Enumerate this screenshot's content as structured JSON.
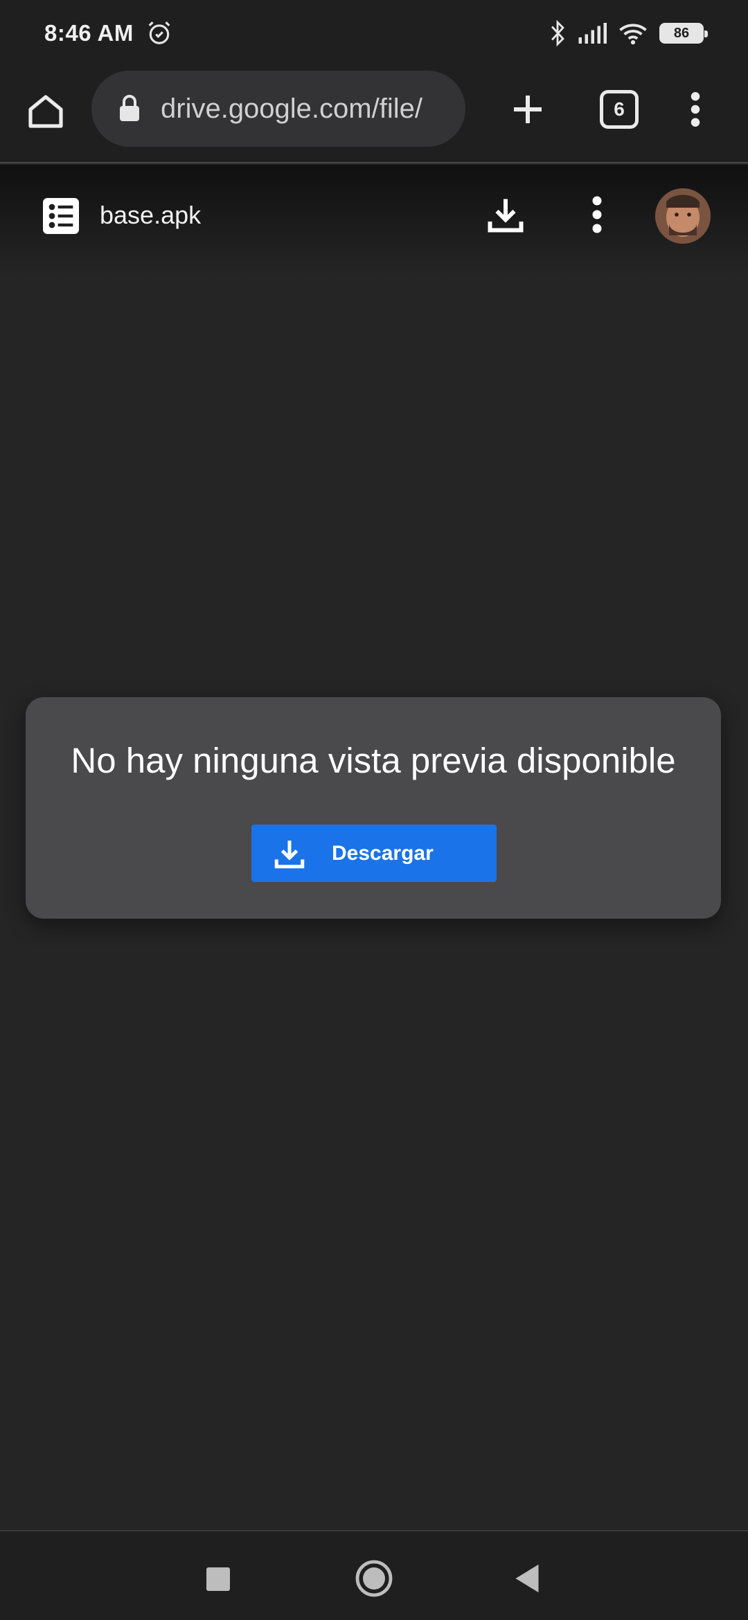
{
  "status_bar": {
    "time": "8:46 AM",
    "battery_level": "86",
    "icons": [
      "alarm-icon",
      "bluetooth-icon",
      "signal-icon",
      "wifi-icon",
      "battery-icon"
    ]
  },
  "browser": {
    "url": "drive.google.com/file/",
    "tab_count": "6",
    "icons": [
      "home-icon",
      "lock-icon",
      "new-tab-icon",
      "tab-switcher-icon",
      "more-vert-icon"
    ]
  },
  "drive": {
    "file_name": "base.apk",
    "icons": [
      "file-type-icon",
      "download-icon",
      "more-vert-icon",
      "avatar"
    ]
  },
  "preview": {
    "message": "No hay ninguna vista previa disponible",
    "download_label": "Descargar"
  },
  "colors": {
    "background": "#252525",
    "card": "#4a494c",
    "accent": "#1a73e8"
  },
  "nav_bar": {
    "icons": [
      "recents-icon",
      "home-circle-icon",
      "back-icon"
    ]
  }
}
